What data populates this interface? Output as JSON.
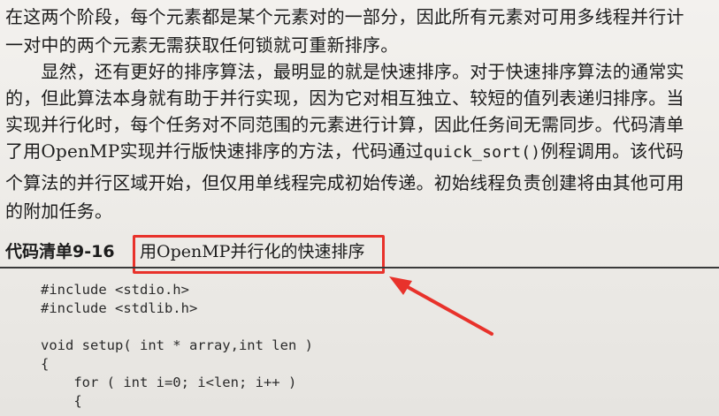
{
  "paragraph_lines": [
    "在这两个阶段，每个元素都是某个元素对的一部分，因此所有元素对可用多线程并行计",
    "一对中的两个元素无需获取任何锁就可重新排序。",
    "　　显然，还有更好的排序算法，最明显的就是快速排序。对于快速排序算法的通常实",
    "的，但此算法本身就有助于并行实现，因为它对相互独立、较短的值列表递归排序。当",
    "实现并行化时，每个任务对不同范围的元素进行计算，因此任务间无需同步。代码清单",
    "了用OpenMP实现并行版快速排序的方法，代码通过",
    "quick_sort()",
    "例程调用。该代码",
    "个算法的并行区域开始，但仅用单线程完成初始传递。初始线程负责创建将由其他可用",
    "的附加任务。"
  ],
  "listing": {
    "label": "代码清单9-16",
    "caption": "用OpenMP并行化的快速排序"
  },
  "code_lines": [
    "#include <stdio.h>",
    "#include <stdlib.h>",
    "",
    "void setup( int * array,int len )",
    "{",
    "    for ( int i=0; i<len; i++ )",
    "    {"
  ],
  "colors": {
    "annotation": "#e8322b"
  }
}
